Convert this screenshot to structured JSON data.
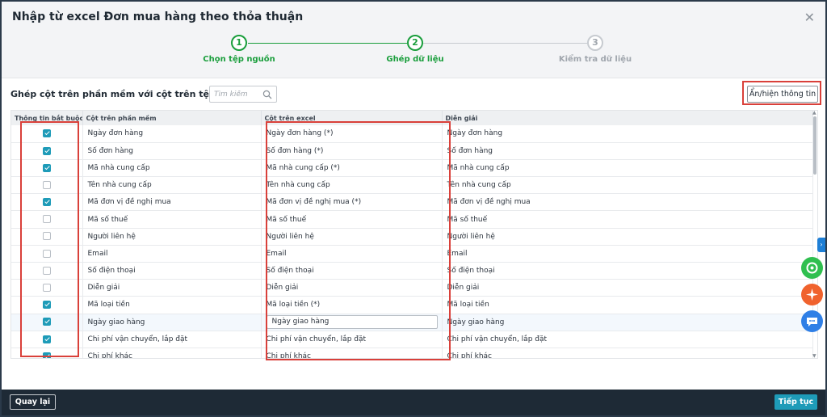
{
  "dialog": {
    "title": "Nhập từ excel Đơn mua hàng theo thỏa thuận",
    "close_icon": "close-icon"
  },
  "stepper": {
    "steps": [
      {
        "number": "1",
        "label": "Chọn tệp nguồn",
        "state": "done"
      },
      {
        "number": "2",
        "label": "Ghép dữ liệu",
        "state": "active"
      },
      {
        "number": "3",
        "label": "Kiểm tra dữ liệu",
        "state": "pending"
      }
    ]
  },
  "toolbar": {
    "label": "Ghép cột trên phần mềm với cột trên tệp dữ liệu",
    "search_placeholder": "Tìm kiếm",
    "toggle_label": "Ẩn/hiện thông tin"
  },
  "table": {
    "columns": [
      "Thông tin bắt buộc",
      "Cột trên phần mềm",
      "Cột trên excel",
      "Diễn giải"
    ],
    "rows": [
      {
        "required": true,
        "software": "Ngày đơn hàng",
        "excel": "Ngày đơn hàng (*)",
        "desc": "Ngày đơn hàng",
        "editing": false
      },
      {
        "required": true,
        "software": "Số đơn hàng",
        "excel": "Số đơn hàng (*)",
        "desc": "Số đơn hàng",
        "editing": false
      },
      {
        "required": true,
        "software": "Mã nhà cung cấp",
        "excel": "Mã nhà cung cấp (*)",
        "desc": "Mã nhà cung cấp",
        "editing": false
      },
      {
        "required": false,
        "software": "Tên nhà cung cấp",
        "excel": "Tên nhà cung cấp",
        "desc": "Tên nhà cung cấp",
        "editing": false
      },
      {
        "required": true,
        "software": "Mã đơn vị đề nghị mua",
        "excel": "Mã đơn vị đề nghị mua (*)",
        "desc": "Mã đơn vị đề nghị mua",
        "editing": false
      },
      {
        "required": false,
        "software": "Mã số thuế",
        "excel": "Mã số thuế",
        "desc": "Mã số thuế",
        "editing": false
      },
      {
        "required": false,
        "software": "Người liên hệ",
        "excel": "Người liên hệ",
        "desc": "Người liên hệ",
        "editing": false
      },
      {
        "required": false,
        "software": "Email",
        "excel": "Email",
        "desc": "Email",
        "editing": false
      },
      {
        "required": false,
        "software": "Số điện thoại",
        "excel": "Số điện thoại",
        "desc": "Số điện thoại",
        "editing": false
      },
      {
        "required": false,
        "software": "Diễn giải",
        "excel": "Diễn giải",
        "desc": "Diễn giải",
        "editing": false
      },
      {
        "required": true,
        "software": "Mã loại tiền",
        "excel": "Mã loại tiền (*)",
        "desc": "Mã loại tiền",
        "editing": false
      },
      {
        "required": true,
        "software": "Ngày giao hàng",
        "excel": "Ngày giao hàng",
        "desc": "Ngày giao hàng",
        "editing": true
      },
      {
        "required": true,
        "software": "Chi phí vận chuyển, lắp đặt",
        "excel": "Chi phí vận chuyển, lắp đặt",
        "desc": "Chi phí vận chuyển, lắp đặt",
        "editing": false
      },
      {
        "required": true,
        "software": "Chi phí khác",
        "excel": "Chi phí khác",
        "desc": "Chi phí khác",
        "editing": false
      }
    ]
  },
  "footer": {
    "back_label": "Quay lại",
    "next_label": "Tiếp tục"
  },
  "colors": {
    "accent_green": "#1a9e3c",
    "accent_teal": "#1e9bb8",
    "highlight_red": "#d9403a",
    "footer_bg": "#1e2a36"
  },
  "floating_buttons": [
    "chat-support-icon",
    "sparkle-ai-icon",
    "message-icon"
  ]
}
